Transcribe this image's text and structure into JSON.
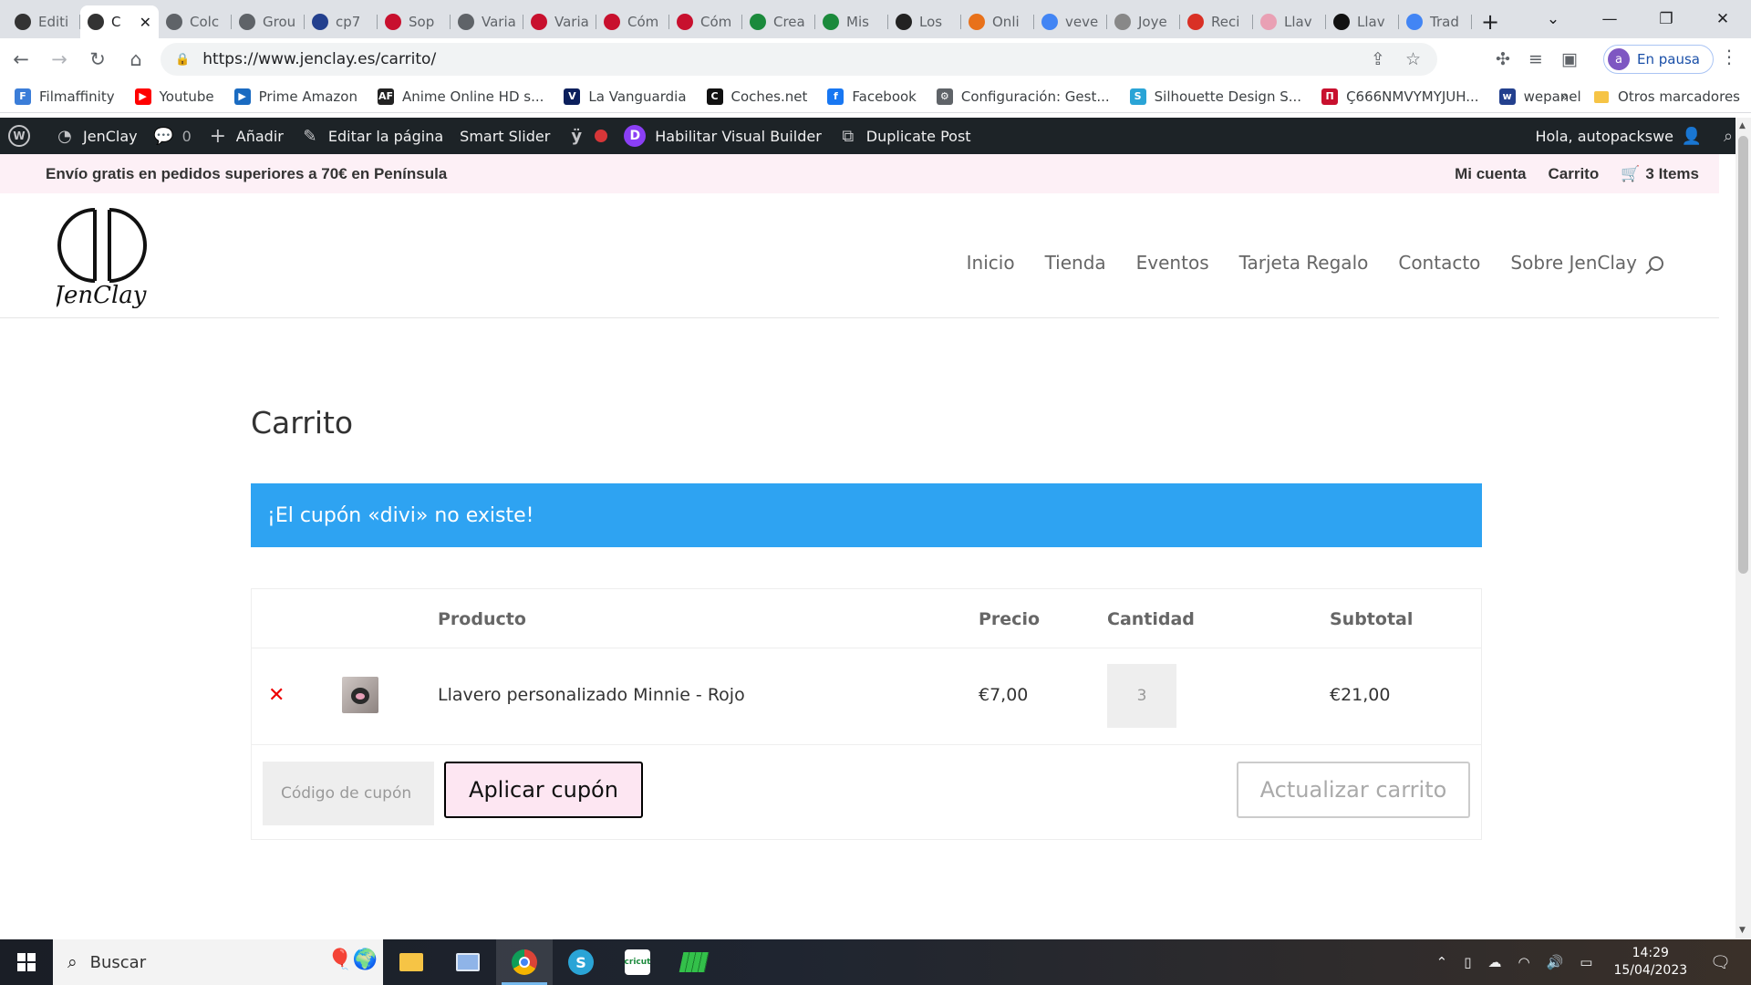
{
  "browser": {
    "tabs": [
      {
        "label": "Editi",
        "color": "#333333"
      },
      {
        "label": "C",
        "color": "#333333",
        "active": true
      },
      {
        "label": "Colc",
        "color": "#5f6368"
      },
      {
        "label": "Grou",
        "color": "#5f6368"
      },
      {
        "label": "cp7",
        "color": "#23408e"
      },
      {
        "label": "Sop",
        "color": "#c8102e"
      },
      {
        "label": "Varia",
        "color": "#5f6368"
      },
      {
        "label": "Varia",
        "color": "#c8102e"
      },
      {
        "label": "Cóm",
        "color": "#c8102e"
      },
      {
        "label": "Cóm",
        "color": "#c8102e"
      },
      {
        "label": "Crea",
        "color": "#1b8a3c"
      },
      {
        "label": "Mis",
        "color": "#1b8a3c"
      },
      {
        "label": "Los",
        "color": "#222222"
      },
      {
        "label": "Onli",
        "color": "#e8711a"
      },
      {
        "label": "veve",
        "color": "#4285f4"
      },
      {
        "label": "Joye",
        "color": "#888888"
      },
      {
        "label": "Reci",
        "color": "#d93025"
      },
      {
        "label": "Llav",
        "color": "#e9a0b4"
      },
      {
        "label": "Llav",
        "color": "#111111"
      },
      {
        "label": "Trad",
        "color": "#4285f4"
      }
    ],
    "url": "https://www.jenclay.es/carrito/",
    "profile_initial": "a",
    "profile_label": "En pausa",
    "bookmarks": [
      {
        "label": "Filmaffinity",
        "color": "#3b7dd8",
        "glyph": "F"
      },
      {
        "label": "Youtube",
        "color": "#ff0000",
        "glyph": "▶"
      },
      {
        "label": "Prime Amazon",
        "color": "#1a6bc1",
        "glyph": "▶"
      },
      {
        "label": "Anime Online HD s...",
        "color": "#222222",
        "glyph": "AF"
      },
      {
        "label": "La Vanguardia",
        "color": "#0b1f5c",
        "glyph": "V"
      },
      {
        "label": "Coches.net",
        "color": "#111111",
        "glyph": "C"
      },
      {
        "label": "Facebook",
        "color": "#1877f2",
        "glyph": "f"
      },
      {
        "label": "Configuración: Gest...",
        "color": "#5f6368",
        "glyph": "⚙"
      },
      {
        "label": "Silhouette Design S...",
        "color": "#2aa4d6",
        "glyph": "S"
      },
      {
        "label": "Ç666NMVYMYJUH...",
        "color": "#c8102e",
        "glyph": "П"
      },
      {
        "label": "wepanel",
        "color": "#23408e",
        "glyph": "w"
      }
    ],
    "bookmarks_more": "»",
    "other_bookmarks": "Otros marcadores"
  },
  "adminbar": {
    "site_name": "JenClay",
    "comments_count": "0",
    "add_label": "Añadir",
    "edit_label": "Editar la página",
    "slider_label": "Smart Slider",
    "divi_label": "Habilitar Visual Builder",
    "duplicate_label": "Duplicate Post",
    "greeting": "Hola, autopackswe"
  },
  "site": {
    "promo": "Envío gratis en pedidos superiores a 70€ en Península",
    "my_account": "Mi cuenta",
    "cart_link": "Carrito",
    "cart_items": "3 Items",
    "logo_text": "JenClay",
    "nav": [
      "Inicio",
      "Tienda",
      "Eventos",
      "Tarjeta Regalo",
      "Contacto",
      "Sobre JenClay"
    ]
  },
  "cart": {
    "title": "Carrito",
    "notice": "¡El cupón «divi» no existe!",
    "headers": {
      "product": "Producto",
      "price": "Precio",
      "quantity": "Cantidad",
      "subtotal": "Subtotal"
    },
    "items": [
      {
        "name": "Llavero personalizado Minnie - Rojo",
        "price": "€7,00",
        "quantity": "3",
        "subtotal": "€21,00"
      }
    ],
    "coupon_placeholder": "Código de cupón",
    "apply_label": "Aplicar cupón",
    "update_label": "Actualizar carrito"
  },
  "taskbar": {
    "search_label": "Buscar",
    "time": "14:29",
    "date": "15/04/2023"
  }
}
